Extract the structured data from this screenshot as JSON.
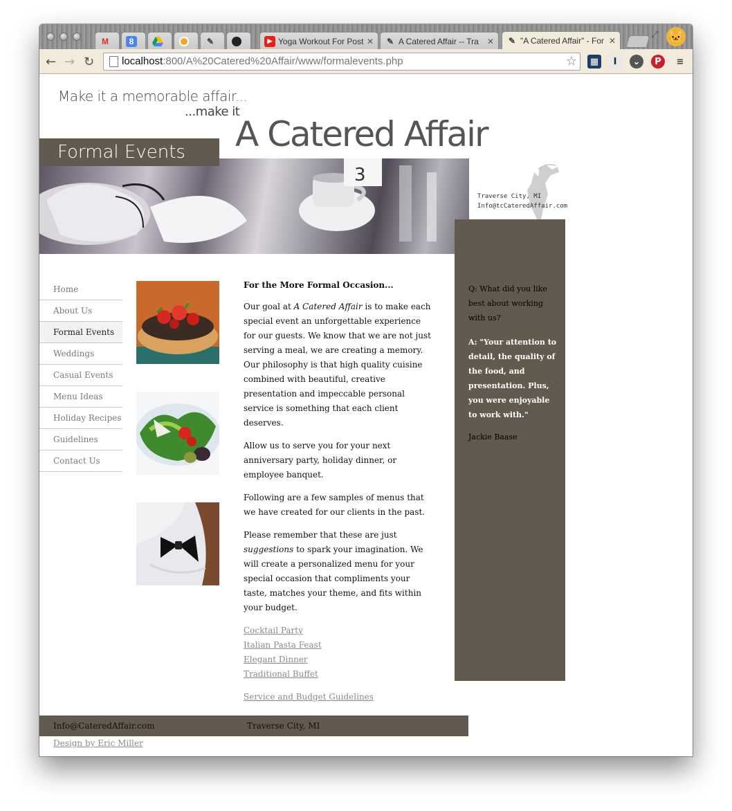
{
  "browser": {
    "tabs": [
      {
        "title": "",
        "icon": "gmail-icon"
      },
      {
        "title": "",
        "icon": "calendar-icon",
        "badge": "8"
      },
      {
        "title": "",
        "icon": "drive-icon"
      },
      {
        "title": "",
        "icon": "orange-circle-icon"
      },
      {
        "title": "",
        "icon": "page-icon"
      },
      {
        "title": "",
        "icon": "github-icon"
      },
      {
        "title": "Yoga Workout For Post",
        "icon": "youtube-icon"
      },
      {
        "title": "A Catered Affair -- Tra",
        "icon": "page-icon"
      },
      {
        "title": "\"A Catered Affair\" - For",
        "icon": "page-icon",
        "active": true
      }
    ],
    "url_host": "localhost",
    "url_rest": ":800/A%20Catered%20Affair/www/formalevents.php"
  },
  "header": {
    "tagline_1": "Make it a memorable affair...",
    "tagline_2": "...make it",
    "brand": "A Catered Affair",
    "section_title": "Formal Events"
  },
  "contact": {
    "city": "Traverse City, MI",
    "email": "Info@tcCateredAffair.com"
  },
  "nav": {
    "items": [
      {
        "label": "Home"
      },
      {
        "label": "About Us"
      },
      {
        "label": "Formal Events",
        "active": true
      },
      {
        "label": "Weddings"
      },
      {
        "label": "Casual Events"
      },
      {
        "label": "Menu Ideas"
      },
      {
        "label": "Holiday Recipes"
      },
      {
        "label": "Guidelines"
      },
      {
        "label": "Contact Us"
      }
    ]
  },
  "content": {
    "heading": "For the More Formal Occasion...",
    "p1_a": "Our goal at ",
    "p1_em": "A Catered Affair",
    "p1_b": " is to make each special event an unforgettable experience for our guests. We know that we are not just serving a meal, we are creating a memory. Our philosophy is that high quality cuisine combined with beautiful, creative presentation and impeccable personal service is something that each client deserves.",
    "p2": "Allow us to serve you for your next anniversary party, holiday dinner, or employee banquet.",
    "p3": "Following are a few samples of menus that we have created for our clients in the past.",
    "p4_a": "Please remember that these are just ",
    "p4_em": "suggestions",
    "p4_b": " to spark your imagination. We will create a personalized menu for your special occasion that compliments your taste, matches your theme, and fits within your budget.",
    "links": [
      "Cocktail Party",
      "Italian Pasta Feast",
      "Elegant Dinner",
      "Traditional Buffet"
    ],
    "guidelines_link": "Service and Budget Guidelines"
  },
  "testimonial": {
    "question": "Q: What did you like best about working with us?",
    "answer": "A: \"Your attention to detail, the quality of the food, and presentation. Plus, you were enjoyable to work with.\"",
    "author": "Jackie Baase"
  },
  "footer": {
    "email": "Info@CateredAffair.com",
    "city": "Traverse City, MI",
    "credit": "Design by Eric Miller"
  },
  "colors": {
    "brand_brown": "#625a4f",
    "chrome_beige": "#f2eadb"
  }
}
